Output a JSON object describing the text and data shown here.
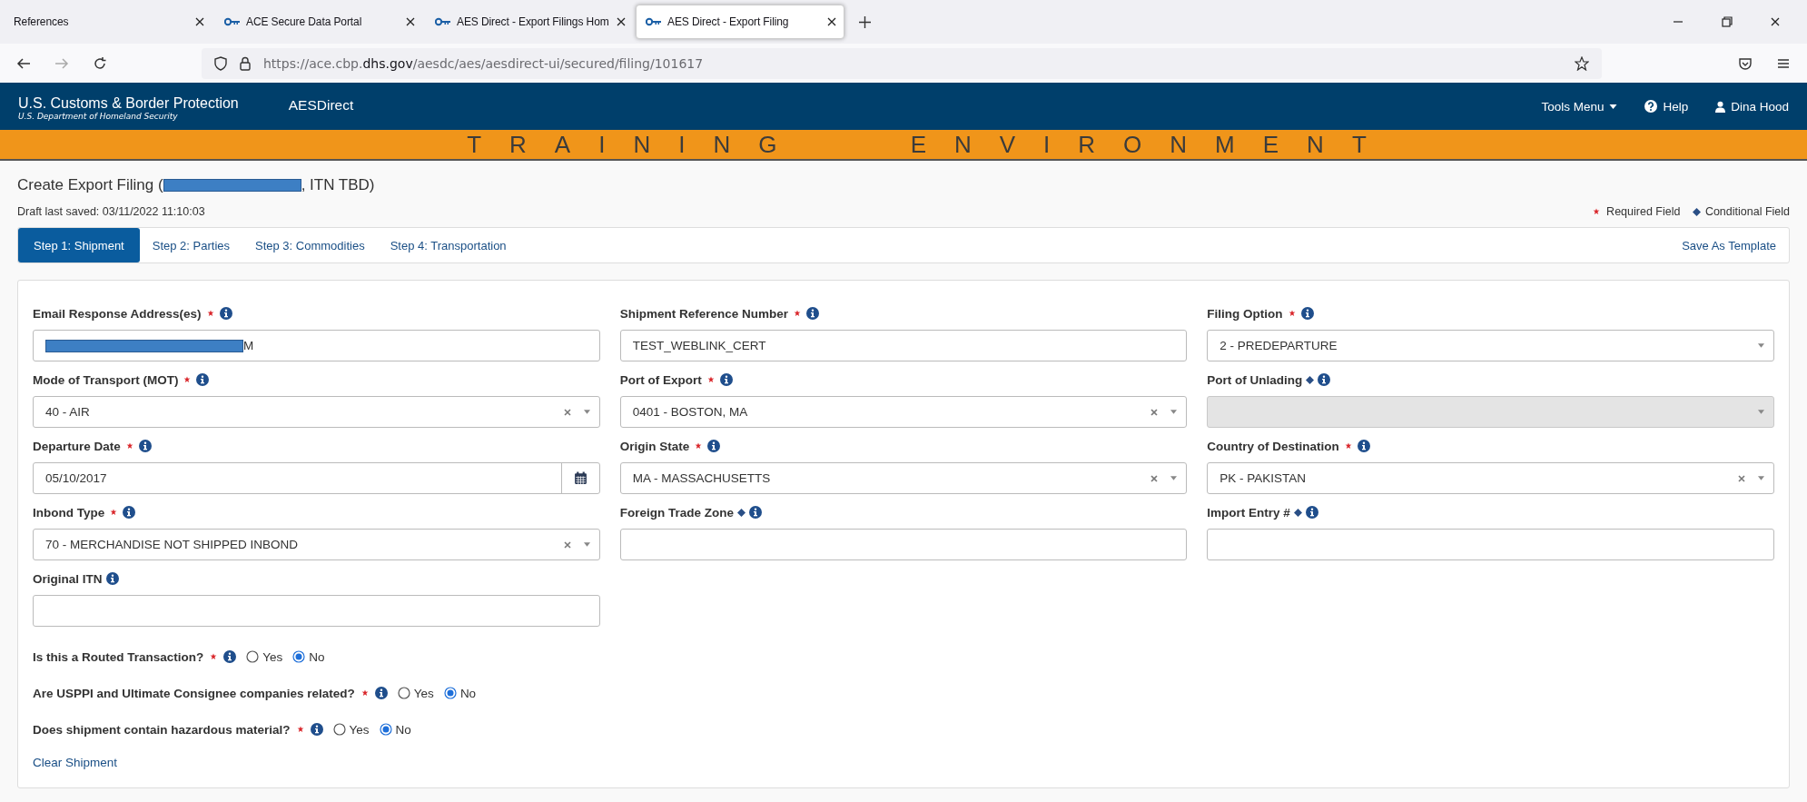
{
  "browser": {
    "tabs": [
      {
        "title": "References",
        "selected": false,
        "has_icon": false
      },
      {
        "title": "ACE Secure Data Portal",
        "selected": false,
        "has_icon": true
      },
      {
        "title": "AES Direct - Export Filings Hom",
        "selected": false,
        "has_icon": true
      },
      {
        "title": "AES Direct - Export Filing",
        "selected": true,
        "has_icon": true
      }
    ],
    "url": {
      "prefix": "https://ace.cbp.",
      "domain": "dhs.gov",
      "path": "/aesdc/aes/aesdirect-ui/secured/filing/101617"
    }
  },
  "header": {
    "agency": "U.S. Customs & Border Protection",
    "department": "U.S. Department of Homeland Security",
    "app": "AESDirect",
    "tools_menu": "Tools Menu",
    "help": "Help",
    "user": "Dina Hood"
  },
  "banner": "TRAINING ENVIRONMENT",
  "page": {
    "title_start": "Create Export Filing (",
    "title_end": ", ITN TBD)",
    "draft": "Draft last saved: 03/11/2022 11:10:03",
    "legend_required": "Required Field",
    "legend_conditional": "Conditional Field"
  },
  "steps": [
    {
      "label": "Step 1: Shipment",
      "selected": true
    },
    {
      "label": "Step 2: Parties",
      "selected": false
    },
    {
      "label": "Step 3: Commodities",
      "selected": false
    },
    {
      "label": "Step 4: Transportation",
      "selected": false
    }
  ],
  "save_template": "Save As Template",
  "fields": [
    {
      "label": "Email Response Address(es)",
      "required": true,
      "conditional": false,
      "kind": "text",
      "value": "M",
      "redacted": true,
      "disabled": false
    },
    {
      "label": "Shipment Reference Number",
      "required": true,
      "conditional": false,
      "kind": "text",
      "value": "TEST_WEBLINK_CERT",
      "redacted": false,
      "disabled": false
    },
    {
      "label": "Filing Option",
      "required": true,
      "conditional": false,
      "kind": "select",
      "value": "2 - PREDEPARTURE",
      "clearable": false,
      "disabled": false
    },
    {
      "label": "Mode of Transport (MOT)",
      "required": true,
      "conditional": false,
      "kind": "select",
      "value": "40 - AIR",
      "clearable": true,
      "disabled": false
    },
    {
      "label": "Port of Export",
      "required": true,
      "conditional": false,
      "kind": "select",
      "value": "0401 - BOSTON, MA",
      "clearable": true,
      "disabled": false
    },
    {
      "label": "Port of Unlading",
      "required": false,
      "conditional": true,
      "kind": "select",
      "clearable": false,
      "disabled": true
    },
    {
      "label": "Departure Date",
      "required": true,
      "conditional": false,
      "kind": "date",
      "value": "05/10/2017",
      "disabled": false
    },
    {
      "label": "Origin State",
      "required": true,
      "conditional": false,
      "kind": "select",
      "value": "MA - MASSACHUSETTS",
      "clearable": true,
      "disabled": false
    },
    {
      "label": "Country of Destination",
      "required": true,
      "conditional": false,
      "kind": "select",
      "value": "PK - PAKISTAN",
      "clearable": true,
      "disabled": false
    },
    {
      "label": "Inbond Type",
      "required": true,
      "conditional": false,
      "kind": "select",
      "value": "70 - MERCHANDISE NOT SHIPPED INBOND",
      "clearable": true,
      "disabled": false
    },
    {
      "label": "Foreign Trade Zone",
      "required": false,
      "conditional": true,
      "kind": "text",
      "redacted": false,
      "disabled": false
    },
    {
      "label": "Import Entry #",
      "required": false,
      "conditional": true,
      "kind": "text",
      "redacted": false,
      "disabled": false
    },
    {
      "label": "Original ITN",
      "required": false,
      "conditional": false,
      "kind": "text",
      "redacted": false,
      "disabled": false
    }
  ],
  "questions": [
    {
      "label": "Is this a Routed Transaction?",
      "required": true,
      "options": [
        {
          "label": "Yes",
          "selected": false
        },
        {
          "label": "No",
          "selected": true
        }
      ]
    },
    {
      "label": "Are USPPI and Ultimate Consignee companies related?",
      "required": true,
      "options": [
        {
          "label": "Yes",
          "selected": false
        },
        {
          "label": "No",
          "selected": true
        }
      ]
    },
    {
      "label": "Does shipment contain hazardous material?",
      "required": true,
      "options": [
        {
          "label": "Yes",
          "selected": false
        },
        {
          "label": "No",
          "selected": true
        }
      ]
    }
  ],
  "clear_link": "Clear Shipment"
}
